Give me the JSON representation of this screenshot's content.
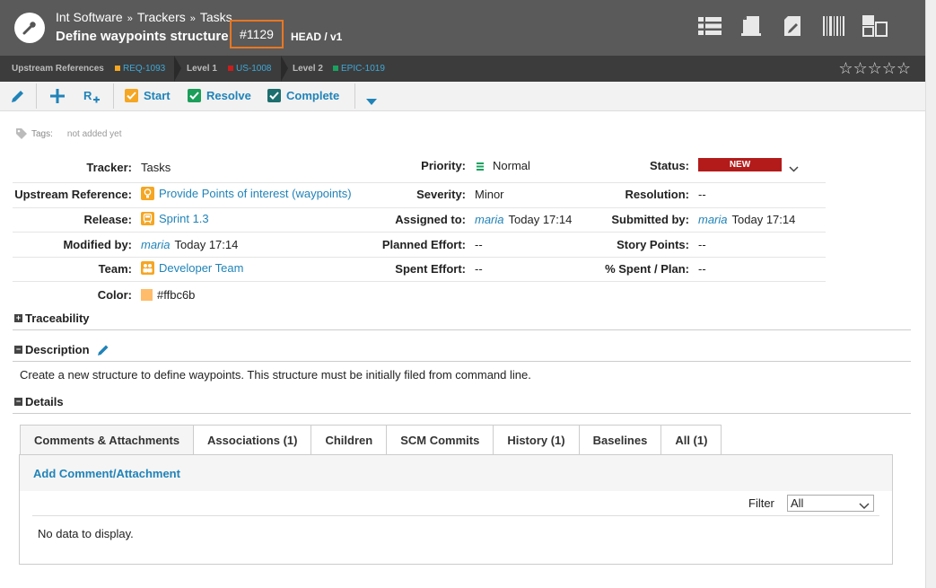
{
  "header": {
    "breadcrumb": [
      "Int Software",
      "Trackers",
      "Tasks"
    ],
    "breadcrumb_sep": "»",
    "title": "Define waypoints structure",
    "item_id": "#1129",
    "version": "HEAD / v1",
    "icons": [
      "list-icon",
      "document-icon",
      "edit-document-icon",
      "barcode-icon",
      "layout-icon"
    ]
  },
  "refbar": {
    "label": "Upstream References",
    "ref1": "REQ-1093",
    "level1": "Level 1",
    "ref2": "US-1008",
    "level2": "Level 2",
    "ref3": "EPIC-1019",
    "stars": "☆☆☆☆☆",
    "colors": {
      "req": "#f5a623",
      "us": "#c81e1e",
      "epic": "#1aa260"
    }
  },
  "toolbar": {
    "start": "Start",
    "resolve": "Resolve",
    "complete": "Complete",
    "colors": {
      "start": "#f5a623",
      "resolve": "#1a9e5a",
      "complete": "#1d6e6e"
    }
  },
  "tags": {
    "label": "Tags:",
    "value": "not added yet"
  },
  "fields": {
    "tracker_label": "Tracker:",
    "tracker": "Tasks",
    "upstream_label": "Upstream Reference:",
    "upstream": "Provide Points of interest (waypoints)",
    "release_label": "Release:",
    "release": "Sprint 1.3",
    "modified_label": "Modified by:",
    "modified_user": "maria",
    "modified_time": "Today 17:14",
    "team_label": "Team:",
    "team": "Developer Team",
    "color_label": "Color:",
    "color": "#ffbc6b",
    "priority_label": "Priority:",
    "priority": "Normal",
    "severity_label": "Severity:",
    "severity": "Minor",
    "assigned_label": "Assigned to:",
    "assigned_user": "maria",
    "assigned_time": "Today 17:14",
    "planned_label": "Planned Effort:",
    "planned": "--",
    "spent_label": "Spent Effort:",
    "spent": "--",
    "status_label": "Status:",
    "status": "NEW",
    "resolution_label": "Resolution:",
    "resolution": "--",
    "submitted_label": "Submitted by:",
    "submitted_user": "maria",
    "submitted_time": "Today 17:14",
    "story_label": "Story Points:",
    "story": "--",
    "spentplan_label": "% Spent / Plan:",
    "spentplan": "--"
  },
  "sections": {
    "traceability": "Traceability",
    "description": "Description",
    "description_text": "Create a new structure to define waypoints. This structure must be initially filed from command line.",
    "details": "Details"
  },
  "tabs": [
    "Comments & Attachments",
    "Associations (1)",
    "Children",
    "SCM Commits",
    "History (1)",
    "Baselines",
    "All (1)"
  ],
  "panel": {
    "add_comment": "Add Comment/Attachment",
    "filter_label": "Filter",
    "filter_value": "All",
    "no_data": "No data to display."
  }
}
